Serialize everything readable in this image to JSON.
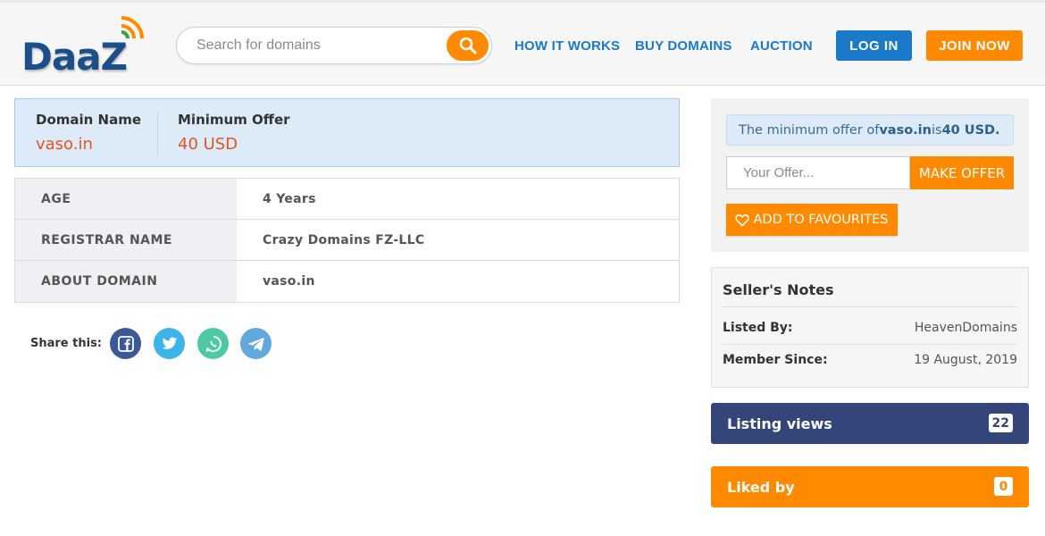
{
  "brand": {
    "logo_text": "DaaZ"
  },
  "search": {
    "placeholder": "Search for domains"
  },
  "nav": [
    {
      "label": "HOW IT WORKS"
    },
    {
      "label": "BUY DOMAINS"
    },
    {
      "label": "AUCTION"
    }
  ],
  "auth": {
    "login_label": "LOG IN",
    "join_label": "JOIN NOW"
  },
  "summary": {
    "name_label": "Domain Name",
    "name_value": "vaso.in",
    "offer_label": "Minimum Offer",
    "offer_value": "40 USD"
  },
  "details": [
    {
      "key": "AGE",
      "value": "4 Years"
    },
    {
      "key": "REGISTRAR NAME",
      "value": "Crazy Domains FZ-LLC"
    },
    {
      "key": "ABOUT DOMAIN",
      "value": "vaso.in"
    }
  ],
  "share": {
    "label": "Share this:",
    "icons": [
      "facebook-icon",
      "twitter-icon",
      "whatsapp-icon",
      "telegram-icon"
    ]
  },
  "offer": {
    "note_prefix": "The minimum offer of ",
    "note_domain": "vaso.in",
    "note_middle": " is ",
    "note_amount": "40 USD.",
    "input_placeholder": "Your Offer...",
    "make_offer_label": "MAKE OFFER",
    "favourites_label": "ADD TO FAVOURITES"
  },
  "seller": {
    "title": "Seller's Notes",
    "listed_by_label": "Listed By:",
    "listed_by_value": "HeavenDomains",
    "member_since_label": "Member Since:",
    "member_since_value": "19 August, 2019"
  },
  "stats": {
    "views_label": "Listing views",
    "views_count": "22",
    "liked_label": "Liked by",
    "liked_count": "0"
  },
  "colors": {
    "accent_orange": "#ff8a00",
    "primary_blue": "#1a7ac9",
    "views_bg": "#344679",
    "price_red": "#e8531f"
  }
}
